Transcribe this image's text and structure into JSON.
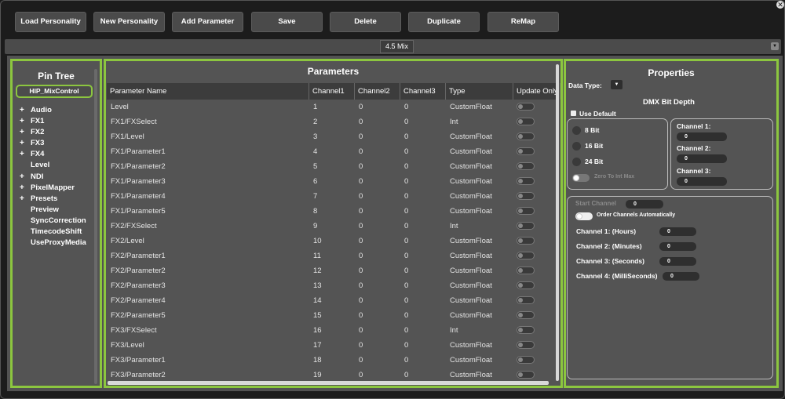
{
  "toolbar": {
    "load_personality": "Load Personality",
    "new_personality": "New Personality",
    "add_parameter": "Add Parameter",
    "save": "Save",
    "delete": "Delete",
    "duplicate": "Duplicate",
    "remap": "ReMap"
  },
  "title_chip": "4.5 Mix",
  "pin_tree": {
    "title": "Pin Tree",
    "root": "HIP_MixControl",
    "items": [
      {
        "label": "Audio",
        "expandable": true
      },
      {
        "label": "FX1",
        "expandable": true
      },
      {
        "label": "FX2",
        "expandable": true
      },
      {
        "label": "FX3",
        "expandable": true
      },
      {
        "label": "FX4",
        "expandable": true
      },
      {
        "label": "Level",
        "expandable": false
      },
      {
        "label": "NDI",
        "expandable": true
      },
      {
        "label": "PixelMapper",
        "expandable": true
      },
      {
        "label": "Presets",
        "expandable": true
      },
      {
        "label": "Preview",
        "expandable": false
      },
      {
        "label": "SyncCorrection",
        "expandable": false
      },
      {
        "label": "TimecodeShift",
        "expandable": false
      },
      {
        "label": "UseProxyMedia",
        "expandable": false
      }
    ]
  },
  "parameters": {
    "title": "Parameters",
    "columns": [
      "Parameter Name",
      "Channel1",
      "Channel2",
      "Channel3",
      "Type",
      "Update Only"
    ],
    "rows": [
      [
        "Level",
        "1",
        "0",
        "0",
        "CustomFloat"
      ],
      [
        "FX1/FXSelect",
        "2",
        "0",
        "0",
        "Int"
      ],
      [
        "FX1/Level",
        "3",
        "0",
        "0",
        "CustomFloat"
      ],
      [
        "FX1/Parameter1",
        "4",
        "0",
        "0",
        "CustomFloat"
      ],
      [
        "FX1/Parameter2",
        "5",
        "0",
        "0",
        "CustomFloat"
      ],
      [
        "FX1/Parameter3",
        "6",
        "0",
        "0",
        "CustomFloat"
      ],
      [
        "FX1/Parameter4",
        "7",
        "0",
        "0",
        "CustomFloat"
      ],
      [
        "FX1/Parameter5",
        "8",
        "0",
        "0",
        "CustomFloat"
      ],
      [
        "FX2/FXSelect",
        "9",
        "0",
        "0",
        "Int"
      ],
      [
        "FX2/Level",
        "10",
        "0",
        "0",
        "CustomFloat"
      ],
      [
        "FX2/Parameter1",
        "11",
        "0",
        "0",
        "CustomFloat"
      ],
      [
        "FX2/Parameter2",
        "12",
        "0",
        "0",
        "CustomFloat"
      ],
      [
        "FX2/Parameter3",
        "13",
        "0",
        "0",
        "CustomFloat"
      ],
      [
        "FX2/Parameter4",
        "14",
        "0",
        "0",
        "CustomFloat"
      ],
      [
        "FX2/Parameter5",
        "15",
        "0",
        "0",
        "CustomFloat"
      ],
      [
        "FX3/FXSelect",
        "16",
        "0",
        "0",
        "Int"
      ],
      [
        "FX3/Level",
        "17",
        "0",
        "0",
        "CustomFloat"
      ],
      [
        "FX3/Parameter1",
        "18",
        "0",
        "0",
        "CustomFloat"
      ],
      [
        "FX3/Parameter2",
        "19",
        "0",
        "0",
        "CustomFloat"
      ]
    ]
  },
  "properties": {
    "title": "Properties",
    "data_type_label": "Data Type:",
    "dmx_bit_depth_label": "DMX Bit Depth",
    "use_default_label": "Use Default",
    "bit_options": [
      "8 Bit",
      "16 Bit",
      "24 Bit"
    ],
    "zero_to_int_max_label": "Zero To Int Max",
    "channel1_label": "Channel 1:",
    "channel1_value": "0",
    "channel2_label": "Channel 2:",
    "channel2_value": "0",
    "channel3_label": "Channel 3:",
    "channel3_value": "0",
    "start_channel_label": "Start Channel",
    "start_channel_value": "0",
    "order_channels_label": "Order Channels Automatically",
    "hours_label": "Channel 1: (Hours)",
    "hours_value": "0",
    "minutes_label": "Channel 2: (Minutes)",
    "minutes_value": "0",
    "seconds_label": "Channel 3: (Seconds)",
    "seconds_value": "0",
    "millis_label": "Channel 4: (MilliSeconds)",
    "millis_value": "0"
  },
  "colors": {
    "accent": "#8cc63f",
    "panel": "#545454",
    "background": "#1c1c1c"
  }
}
